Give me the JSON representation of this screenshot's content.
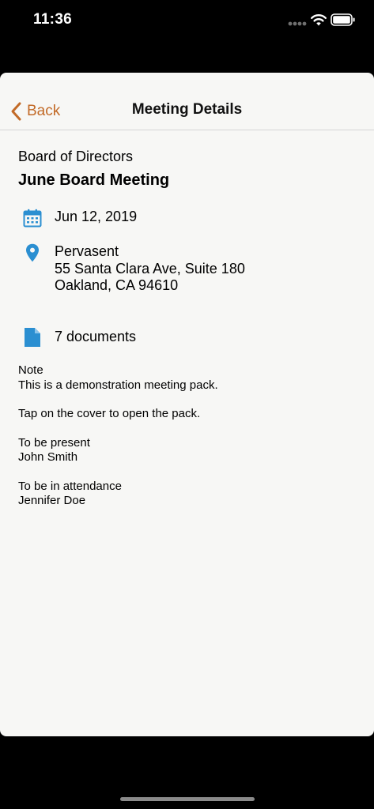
{
  "status_bar": {
    "time": "11:36"
  },
  "nav": {
    "back_label": "Back",
    "title": "Meeting Details"
  },
  "meeting": {
    "organization": "Board of Directors",
    "title": "June Board Meeting",
    "date": "Jun 12, 2019",
    "location": {
      "name": "Pervasent",
      "address_line1": "55 Santa Clara Ave, Suite 180",
      "address_line2": "Oakland, CA 94610"
    },
    "documents": "7 documents"
  },
  "notes": {
    "heading": "Note",
    "line1": "This is a demonstration meeting pack.",
    "line2": "Tap on the cover to open the pack.",
    "present_heading": "To be present",
    "present_name": "John Smith",
    "attendance_heading": "To be in attendance",
    "attendance_name": "Jennifer Doe"
  },
  "icons": {
    "back": "chevron-left-icon",
    "date": "calendar-icon",
    "location": "map-pin-icon",
    "documents": "document-icon"
  },
  "colors": {
    "accent": "#c26a27",
    "icon_blue": "#2b8fd1",
    "sheet_background": "#f7f7f5"
  }
}
